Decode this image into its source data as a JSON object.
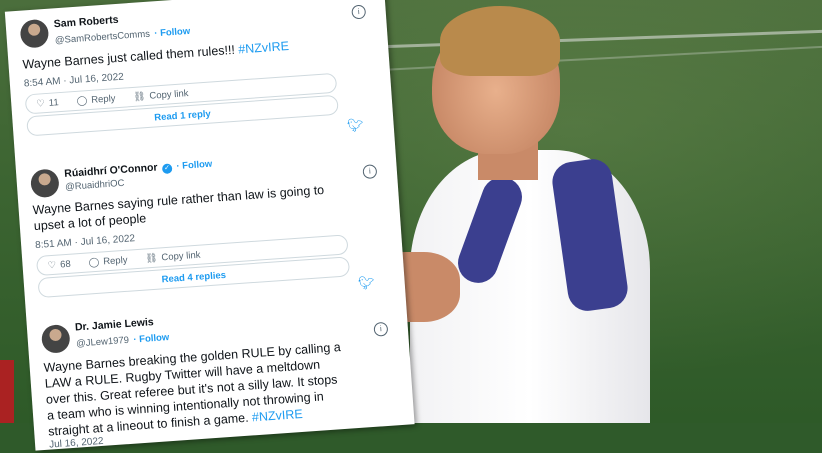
{
  "tweets": [
    {
      "name": "Sam Roberts",
      "handle": "@SamRobertsComms",
      "follow": "· Follow",
      "text": "Wayne Barnes just called them rules!!! ",
      "hashtag": "#NZvIRE",
      "time": "8:54 AM · Jul 16, 2022",
      "likes": "11",
      "reply_label": "Reply",
      "copy_label": "Copy link",
      "replies_label": "Read 1 reply"
    },
    {
      "name": "Rúaidhrí O'Connor",
      "handle": "@RuaidhriOC",
      "follow": "· Follow",
      "text": "Wayne Barnes saying rule rather than law is going to upset a lot of people",
      "time": "8:51 AM · Jul 16, 2022",
      "likes": "68",
      "reply_label": "Reply",
      "copy_label": "Copy link",
      "replies_label": "Read 4 replies"
    },
    {
      "name": "Dr. Jamie Lewis",
      "handle": "@JLew1979",
      "follow": "· Follow",
      "text": "Wayne Barnes breaking the golden RULE by calling a LAW a RULE. Rugby Twitter will have a meltdown over this. Great referee but it's not a silly law. It stops a team who is winning intentionally not throwing in straight at a lineout to finish a game. ",
      "hashtag": "#NZvIRE",
      "time": "Jul 16, 2022"
    }
  ],
  "icons": {
    "info": "info-icon",
    "heart": "heart-icon",
    "reply": "reply-icon",
    "link": "link-icon",
    "bird": "twitter-bird-icon",
    "verified": "verified-badge-icon"
  },
  "colors": {
    "accent": "#1d9bf0",
    "text": "#0f1419",
    "muted": "#536471"
  }
}
